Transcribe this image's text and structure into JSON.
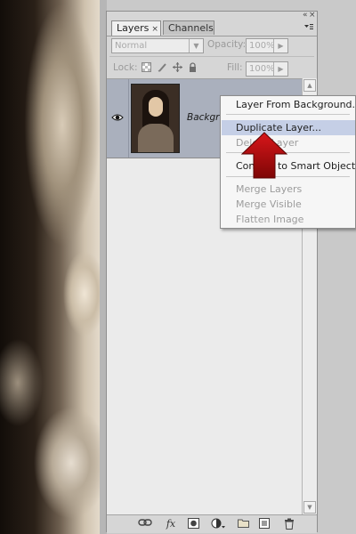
{
  "panel": {
    "tabs": [
      {
        "label": "Layers",
        "close": "×",
        "active": true
      },
      {
        "label": "Channels",
        "active": false
      }
    ],
    "title_controls": {
      "collapse": "«",
      "close": "×"
    },
    "menu_icon": "panel-menu-icon"
  },
  "options": {
    "blend_mode": "Normal",
    "opacity_label": "Opacity:",
    "opacity_value": "100%",
    "lock_label": "Lock:",
    "fill_label": "Fill:",
    "fill_value": "100%",
    "lock_icons": [
      "lock-transparent-pixels-icon",
      "lock-image-pixels-icon",
      "lock-position-icon",
      "lock-all-icon"
    ]
  },
  "layers": [
    {
      "name": "Background",
      "visible": true,
      "selected": true,
      "thumbnail": "portrait-thumbnail"
    }
  ],
  "context_menu": {
    "items": [
      {
        "label": "Layer From Background...",
        "enabled": true,
        "highlighted": false
      },
      {
        "label": "Duplicate Layer...",
        "enabled": true,
        "highlighted": true
      },
      {
        "label": "Delete Layer",
        "enabled": false,
        "highlighted": false
      },
      {
        "label": "Convert to Smart Object",
        "enabled": true,
        "highlighted": false
      },
      {
        "label": "Merge Layers",
        "enabled": false,
        "highlighted": false
      },
      {
        "label": "Merge Visible",
        "enabled": false,
        "highlighted": false
      },
      {
        "label": "Flatten Image",
        "enabled": false,
        "highlighted": false
      }
    ]
  },
  "bottom_bar": {
    "icons": [
      "link-layers-icon",
      "layer-style-fx-icon",
      "add-mask-icon",
      "adjustment-layer-icon",
      "new-group-icon",
      "new-layer-icon",
      "delete-layer-icon"
    ],
    "fx_label": "fx"
  },
  "colors": {
    "accent_highlight": "#c5cfe6",
    "annotation_arrow": "#b20b0b",
    "selected_layer": "#aab0bd"
  }
}
